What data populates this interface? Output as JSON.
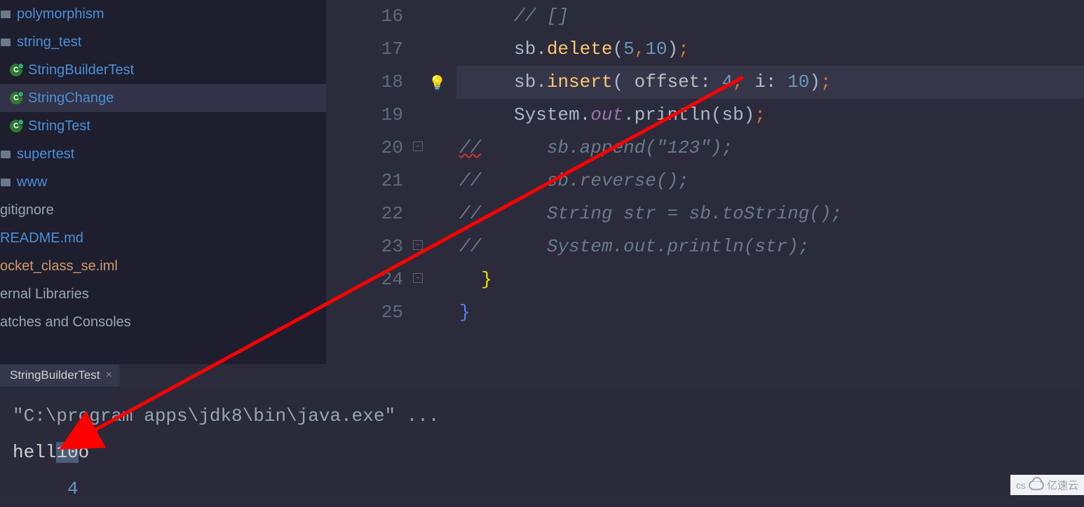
{
  "sidebar": {
    "items": [
      {
        "label": "polymorphism",
        "icon": "folder",
        "cls": "link",
        "indent": "indent1"
      },
      {
        "label": "string_test",
        "icon": "folder",
        "cls": "link",
        "indent": "indent1"
      },
      {
        "label": "StringBuilderTest",
        "icon": "class",
        "cls": "link",
        "indent": "indent2"
      },
      {
        "label": "StringChange",
        "icon": "class",
        "cls": "link",
        "indent": "indent2",
        "selected": true
      },
      {
        "label": "StringTest",
        "icon": "class",
        "cls": "link",
        "indent": "indent2"
      },
      {
        "label": "supertest",
        "icon": "folder",
        "cls": "link",
        "indent": "indent1"
      },
      {
        "label": "www",
        "icon": "folder",
        "cls": "link",
        "indent": "indent1"
      },
      {
        "label": "gitignore",
        "icon": "",
        "cls": "gray",
        "indent": ""
      },
      {
        "label": "README.md",
        "icon": "",
        "cls": "link",
        "indent": ""
      },
      {
        "label": "ocket_class_se.iml",
        "icon": "",
        "cls": "orange",
        "indent": ""
      },
      {
        "label": "ernal Libraries",
        "icon": "",
        "cls": "gray",
        "indent": ""
      },
      {
        "label": "atches and Consoles",
        "icon": "",
        "cls": "gray",
        "indent": ""
      }
    ]
  },
  "editor": {
    "line_numbers": [
      "16",
      "17",
      "18",
      "19",
      "20",
      "21",
      "22",
      "23",
      "24",
      "25"
    ],
    "lines": {
      "l16": "// []",
      "l17_pre": "sb.",
      "l17_m": "delete",
      "l17_args": "(5,10);",
      "l18_pre": "sb.",
      "l18_m": "insert",
      "l18_o": "( ",
      "l18_h1": "offset: ",
      "l18_v1": "4",
      "l18_c": ", ",
      "l18_h2": "i: ",
      "l18_v2": "10",
      "l18_end": ");",
      "l19_a": "System.",
      "l19_b": "out",
      "l19_c": ".println(sb);",
      "l20": "//      sb.append(\"123\");",
      "l21": "//      sb.reverse();",
      "l22": "//      String str = sb.toString();",
      "l23": "//      System.out.println(str);",
      "l24": "}",
      "l25": "}"
    }
  },
  "tab": {
    "label": "StringBuilderTest",
    "close": "×"
  },
  "console": {
    "cmd": "\"C:\\program apps\\jdk8\\bin\\java.exe\" ...",
    "out_pre": "hell",
    "out_hl": "10",
    "out_post": "o",
    "index": "4"
  },
  "watermark": {
    "cs": "cs",
    "brand": "亿速云"
  }
}
